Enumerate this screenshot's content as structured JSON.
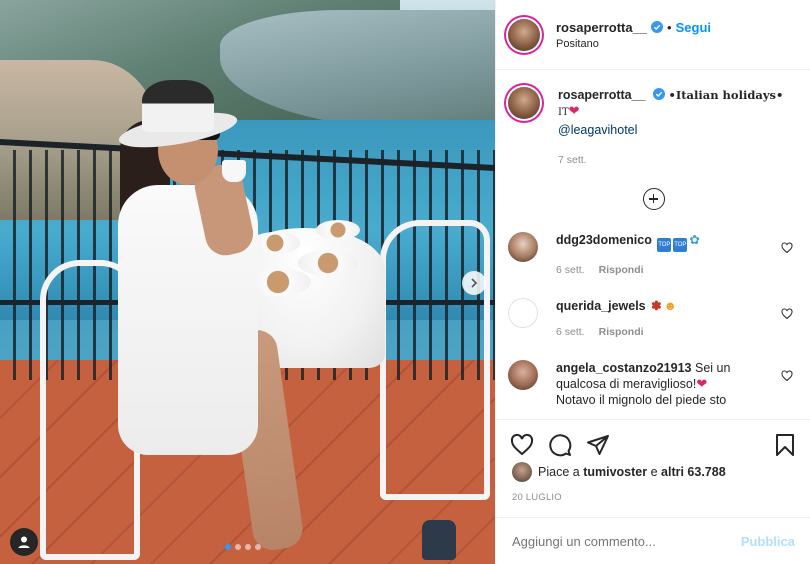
{
  "header": {
    "username": "rosaperrotta__",
    "separator": "•",
    "follow_label": "Segui",
    "location": "Positano"
  },
  "caption": {
    "username": "rosaperrotta__",
    "text": "•Italian holidays•",
    "country": "IT",
    "heart": "❤",
    "mention": "@leagavihotel",
    "date": "7 sett."
  },
  "comments": [
    {
      "username": "ddg23domenico",
      "text": "",
      "time": "6 sett.",
      "reply": "Rispondi"
    },
    {
      "username": "querida_jewels",
      "text": "",
      "time": "6 sett.",
      "reply": "Rispondi"
    },
    {
      "username": "angela_costanzo21913",
      "text": "Sei un qualcosa di meraviglioso!",
      "text2": "Notavo il mignolo del piede sto",
      "time": "",
      "reply": ""
    }
  ],
  "likes": {
    "prefix": "Piace a",
    "user": "tumivoster",
    "middle": "e",
    "others": "altri 63.788"
  },
  "post_date": "20 LUGLIO",
  "add_comment": {
    "placeholder": "Aggiungi un commento...",
    "publish_label": "Pubblica"
  },
  "carousel": {
    "total": 4,
    "active_index": 0
  },
  "colors": {
    "accent": "#0095f6",
    "verified": "#3897f0",
    "publish_disabled": "#b2dffc"
  },
  "icons": [
    "verified-badge-icon",
    "heart-icon",
    "comment-icon",
    "share-icon",
    "bookmark-icon",
    "load-more-icon",
    "user-tag-icon",
    "chevron-right-icon"
  ]
}
